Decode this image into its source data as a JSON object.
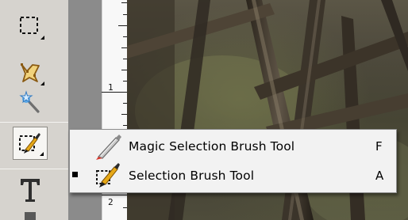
{
  "tools_panel": {
    "tools": [
      {
        "name": "rectangular-marquee-tool"
      },
      {
        "name": "magnetic-lasso-tool"
      },
      {
        "name": "magic-wand-tool"
      },
      {
        "name": "selection-brush-tool"
      },
      {
        "name": "horizontal-type-tool"
      }
    ]
  },
  "ruler": {
    "labels": [
      "1",
      "2"
    ]
  },
  "flyout_menu": {
    "items": [
      {
        "label": "Magic Selection Brush Tool",
        "shortcut": "F",
        "selected": false,
        "icon": "magic-selection-brush-icon"
      },
      {
        "label": "Selection Brush Tool",
        "shortcut": "A",
        "selected": true,
        "icon": "selection-brush-icon"
      }
    ]
  },
  "colors": {
    "panel_bg": "#d6d3ce",
    "ruler_bg": "#f8f8f8",
    "menu_bg": "#f2f2f2",
    "brush_accent": "#e6a817"
  }
}
